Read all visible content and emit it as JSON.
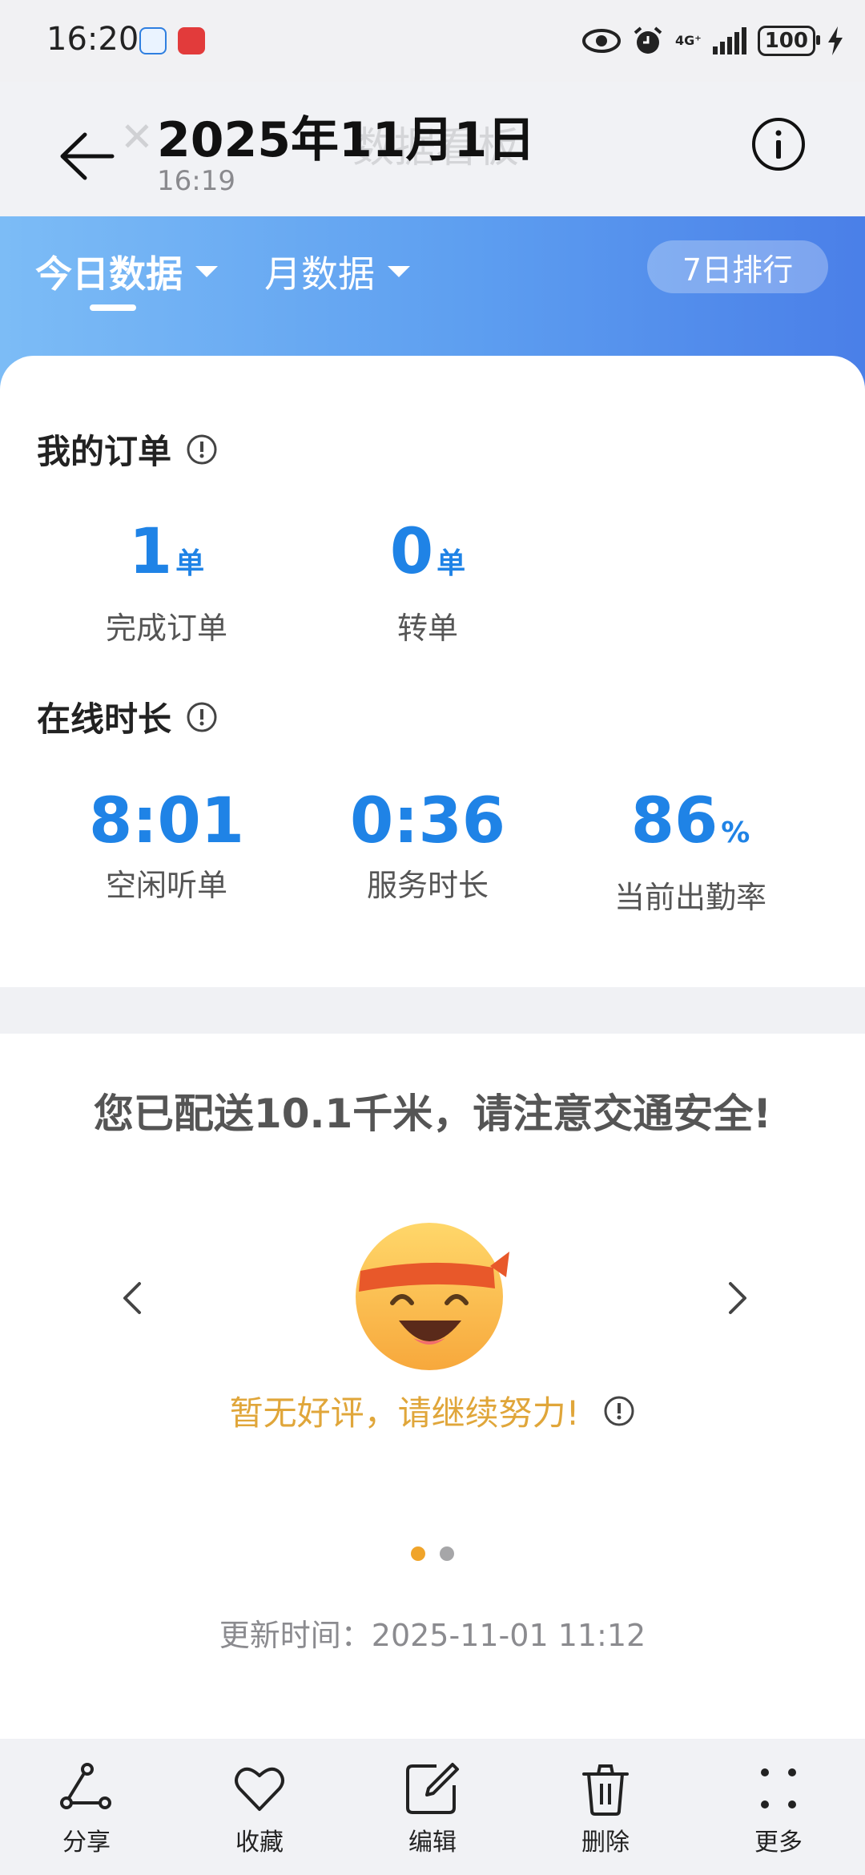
{
  "status_bar": {
    "time": "16:20",
    "network": "4G⁺",
    "battery": "100"
  },
  "header": {
    "ghost_title": "数据看板",
    "date": "2025年11月1日",
    "time": "16:19"
  },
  "tabs": [
    {
      "label": "今日数据",
      "active": true
    },
    {
      "label": "月数据",
      "active": false
    }
  ],
  "rank_button": "7日排行",
  "orders": {
    "title": "我的订单",
    "stats": [
      {
        "value": "1",
        "unit": "单",
        "label": "完成订单"
      },
      {
        "value": "0",
        "unit": "单",
        "label": "转单"
      }
    ]
  },
  "online": {
    "title": "在线时长",
    "stats": [
      {
        "value": "8:01",
        "unit": "",
        "label": "空闲听单"
      },
      {
        "value": "0:36",
        "unit": "",
        "label": "服务时长"
      },
      {
        "value": "86",
        "unit": "%",
        "label": "当前出勤率"
      }
    ]
  },
  "delivery": {
    "message": "您已配送10.1千米，请注意交通安全!",
    "review_text": "暂无好评，请继续努力!",
    "update_time": "更新时间：2025-11-01 11:12"
  },
  "toolbar": [
    {
      "label": "分享",
      "icon": "share-icon"
    },
    {
      "label": "收藏",
      "icon": "heart-icon"
    },
    {
      "label": "编辑",
      "icon": "edit-icon"
    },
    {
      "label": "删除",
      "icon": "trash-icon"
    },
    {
      "label": "更多",
      "icon": "more-icon"
    }
  ],
  "colors": {
    "accent": "#1f83e6",
    "header_start": "#7cbcf6",
    "header_end": "#4a7fe8",
    "review": "#e0a63a"
  }
}
